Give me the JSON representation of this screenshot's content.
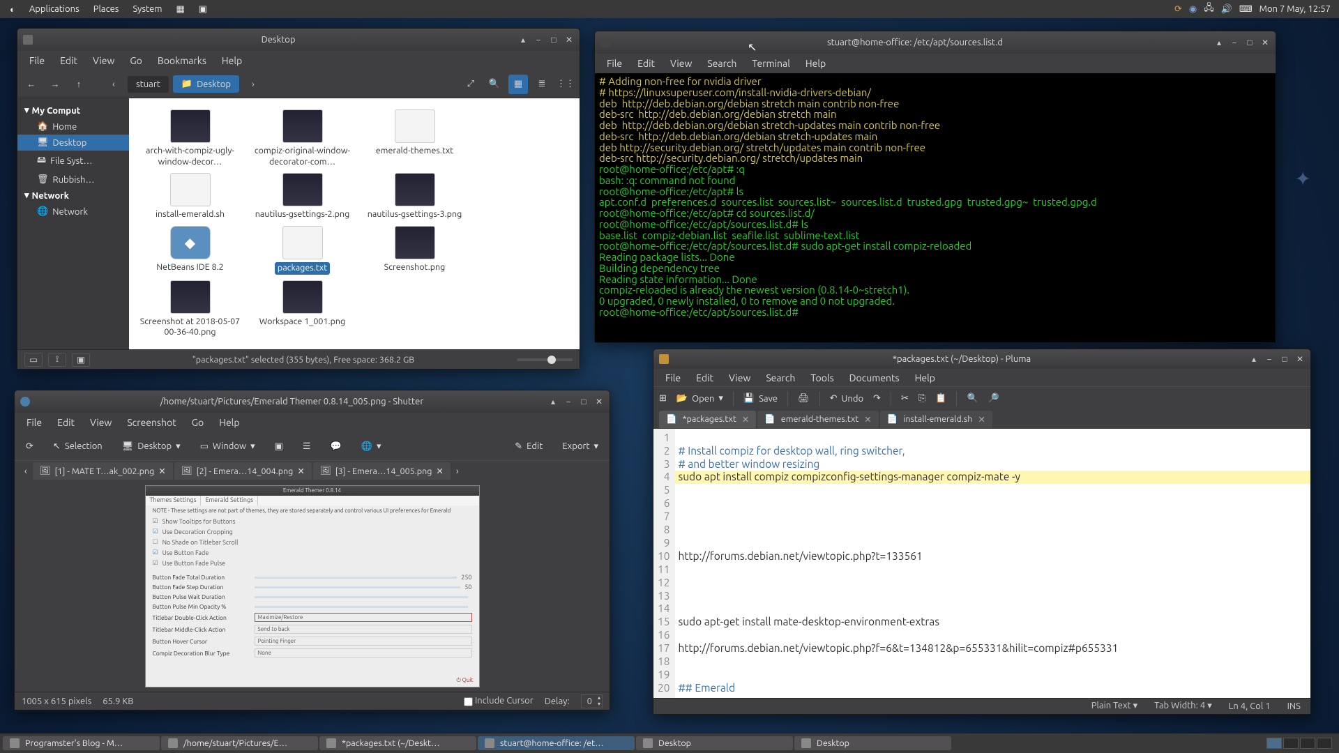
{
  "panel": {
    "menus": [
      "Applications",
      "Places",
      "System"
    ],
    "clock": "Mon  7 May, 12:57"
  },
  "taskbar": {
    "items": [
      "Programster's Blog - M…",
      "/home/stuart/Pictures/E…",
      "*packages.txt (~/Deskt…",
      "stuart@home-office: /et…",
      "Desktop",
      "Desktop"
    ],
    "active_index": 3
  },
  "fm": {
    "title": "Desktop",
    "menu": [
      "File",
      "Edit",
      "View",
      "Go",
      "Bookmarks",
      "Help"
    ],
    "crumb_parent": "stuart",
    "crumb_current": "Desktop",
    "side_header": "My Comput",
    "side": [
      "Home",
      "Desktop",
      "File Syst…",
      "Rubbish…"
    ],
    "side_net_header": "Network",
    "side_net": "Network",
    "files": [
      {
        "name": "arch-with-compiz-ugly-window-decor…",
        "type": "img"
      },
      {
        "name": "compiz-original-window-decorator-com…",
        "type": "img"
      },
      {
        "name": "emerald-themes.txt",
        "type": "txt"
      },
      {
        "name": "install-emerald.sh",
        "type": "txt"
      },
      {
        "name": "nautilus-gsettings-2.png",
        "type": "img"
      },
      {
        "name": "nautilus-gsettings-3.png",
        "type": "img"
      },
      {
        "name": "NetBeans IDE 8.2",
        "type": "app"
      },
      {
        "name": "packages.txt",
        "type": "txt",
        "selected": true
      },
      {
        "name": "Screenshot.png",
        "type": "img"
      },
      {
        "name": "Screenshot at 2018-05-07 00-36-40.png",
        "type": "img"
      },
      {
        "name": "Workspace 1_001.png",
        "type": "img"
      }
    ],
    "status": "\"packages.txt\" selected (355 bytes), Free space: 368.2 GB"
  },
  "term": {
    "title": "stuart@home-office: /etc/apt/sources.list.d",
    "menu": [
      "File",
      "Edit",
      "View",
      "Search",
      "Terminal",
      "Help"
    ],
    "lines": [
      {
        "cls": "c-cmt",
        "t": "# Adding non-free for nvidia driver"
      },
      {
        "cls": "c-cmt",
        "t": "# https://linuxsuperuser.com/install-nvidia-drivers-debian/"
      },
      {
        "cls": "c-cmt",
        "t": "deb  http://deb.debian.org/debian stretch main contrib non-free"
      },
      {
        "cls": "c-cmt",
        "t": "deb-src  http://deb.debian.org/debian stretch main"
      },
      {
        "cls": "c-cmt",
        "t": ""
      },
      {
        "cls": "c-cmt",
        "t": "deb  http://deb.debian.org/debian stretch-updates main contrib non-free"
      },
      {
        "cls": "c-cmt",
        "t": "deb-src  http://deb.debian.org/debian stretch-updates main"
      },
      {
        "cls": "c-cmt",
        "t": ""
      },
      {
        "cls": "c-cmt",
        "t": "deb http://security.debian.org/ stretch/updates main contrib non-free"
      },
      {
        "cls": "c-cmt",
        "t": "deb-src http://security.debian.org/ stretch/updates main"
      },
      {
        "cls": "c-grn",
        "t": "root@home-office:/etc/apt# :q"
      },
      {
        "cls": "c-grn",
        "t": "bash: :q: command not found"
      },
      {
        "cls": "c-grn",
        "t": "root@home-office:/etc/apt# ls"
      },
      {
        "cls": "c-grn",
        "t": "apt.conf.d  preferences.d  sources.list  sources.list~  sources.list.d  trusted.gpg  trusted.gpg~  trusted.gpg.d"
      },
      {
        "cls": "c-grn",
        "t": "root@home-office:/etc/apt# cd sources.list.d/"
      },
      {
        "cls": "c-grn",
        "t": "root@home-office:/etc/apt/sources.list.d# ls"
      },
      {
        "cls": "c-grn",
        "t": "base.list  compiz-debian.list  seafile.list  sublime-text.list"
      },
      {
        "cls": "c-grn",
        "t": "root@home-office:/etc/apt/sources.list.d# sudo apt-get install compiz-reloaded"
      },
      {
        "cls": "c-grn",
        "t": "Reading package lists... Done"
      },
      {
        "cls": "c-grn",
        "t": "Building dependency tree"
      },
      {
        "cls": "c-grn",
        "t": "Reading state information... Done"
      },
      {
        "cls": "c-grn",
        "t": "compiz-reloaded is already the newest version (0.8.14-0~stretch1)."
      },
      {
        "cls": "c-grn",
        "t": "0 upgraded, 0 newly installed, 0 to remove and 0 not upgraded."
      },
      {
        "cls": "c-grn",
        "t": "root@home-office:/etc/apt/sources.list.d# "
      }
    ]
  },
  "pluma": {
    "title": "*packages.txt (~/Desktop) - Pluma",
    "menu": [
      "File",
      "Edit",
      "View",
      "Search",
      "Tools",
      "Documents",
      "Help"
    ],
    "toolbar": {
      "open": "Open",
      "save": "Save",
      "undo": "Undo"
    },
    "tabs": [
      "*packages.txt",
      "emerald-themes.txt",
      "install-emerald.sh"
    ],
    "active_tab": 0,
    "lines": [
      {
        "n": 1,
        "t": "",
        "cls": ""
      },
      {
        "n": 2,
        "t": "# Install compiz for desktop wall, ring switcher,",
        "cls": "cmt"
      },
      {
        "n": 3,
        "t": "# and better window resizing",
        "cls": "cmt"
      },
      {
        "n": 4,
        "t": "sudo apt install compiz compizconfig-settings-manager compiz-mate -y",
        "cls": "hl"
      },
      {
        "n": 5,
        "t": "",
        "cls": ""
      },
      {
        "n": 6,
        "t": "",
        "cls": ""
      },
      {
        "n": 7,
        "t": "",
        "cls": ""
      },
      {
        "n": 8,
        "t": "",
        "cls": ""
      },
      {
        "n": 9,
        "t": "",
        "cls": ""
      },
      {
        "n": 10,
        "t": "http://forums.debian.net/viewtopic.php?t=133561",
        "cls": ""
      },
      {
        "n": 11,
        "t": "",
        "cls": ""
      },
      {
        "n": 12,
        "t": "",
        "cls": ""
      },
      {
        "n": 13,
        "t": "",
        "cls": ""
      },
      {
        "n": 14,
        "t": "",
        "cls": ""
      },
      {
        "n": 15,
        "t": "sudo apt-get install mate-desktop-environment-extras",
        "cls": ""
      },
      {
        "n": 16,
        "t": "",
        "cls": ""
      },
      {
        "n": 17,
        "t": "http://forums.debian.net/viewtopic.php?f=6&t=134812&p=655331&hilit=compiz#p655331",
        "cls": ""
      },
      {
        "n": 18,
        "t": "",
        "cls": ""
      },
      {
        "n": 19,
        "t": "",
        "cls": ""
      },
      {
        "n": 20,
        "t": "## Emerald",
        "cls": "cmt"
      }
    ],
    "status": {
      "mode": "Plain Text",
      "tab": "Tab Width: 4",
      "pos": "Ln 4, Col 1",
      "ins": "INS"
    }
  },
  "shutter": {
    "title": "/home/stuart/Pictures/Emerald Themer 0.8.14_005.png - Shutter",
    "menu": [
      "File",
      "Edit",
      "View",
      "Screenshot",
      "Go",
      "Help"
    ],
    "toolbar": {
      "selection": "Selection",
      "desktop": "Desktop",
      "window": "Window",
      "edit": "Edit",
      "export": "Export"
    },
    "tabs": [
      "[1] - MATE T…ak_002.png",
      "[2] - Emera…14_004.png",
      "[3] - Emera…14_005.png"
    ],
    "status": {
      "dims": "1005 x 615 pixels",
      "size": "65.9 KB",
      "cursor": "Include Cursor",
      "delay_lbl": "Delay:",
      "delay": "0"
    },
    "shot": {
      "title": "Emerald Themer 0.8.14",
      "tabs": [
        "Themes Settings",
        "Emerald Settings"
      ],
      "note": "NOTE - These settings are not part of themes, they are stored separately and control various UI preferences for Emerald",
      "checks": [
        "Show Tooltips for Buttons",
        "Use Decoration Cropping",
        "No Shade on Titlebar Scroll",
        "Use Button Fade",
        "Use Button Fade Pulse"
      ],
      "sliders": [
        "Button Fade Total Duration",
        "Button Fade Step Duration",
        "Button Pulse Wait Duration",
        "Button Pulse Min Opacity %"
      ],
      "sel1_lbl": "Titlebar Double-Click Action",
      "sel1": "Maximize/Restore",
      "sel2_lbl": "Titlebar Middle-Click Action",
      "sel2": "Send to back",
      "sel3_lbl": "Button Hover Cursor",
      "sel3": "Pointing Finger",
      "sel4_lbl": "Compiz Decoration Blur Type",
      "sel4": "None",
      "quit": "Quit"
    }
  }
}
